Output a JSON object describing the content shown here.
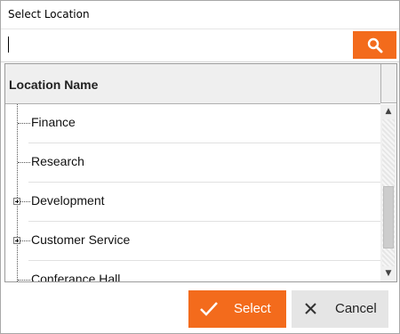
{
  "window": {
    "title": "Select Location"
  },
  "search": {
    "value": "",
    "placeholder": ""
  },
  "grid": {
    "column_header": "Location Name",
    "rows": [
      {
        "label": "Finance",
        "expandable": false
      },
      {
        "label": "Research",
        "expandable": false
      },
      {
        "label": "Development",
        "expandable": true
      },
      {
        "label": "Customer Service",
        "expandable": true
      },
      {
        "label": "Conferance Hall",
        "expandable": false
      }
    ]
  },
  "buttons": {
    "select_label": "Select",
    "cancel_label": "Cancel"
  },
  "icons": {
    "search": "magnifier-icon",
    "select": "checkmark-icon",
    "cancel": "close-x-icon"
  },
  "colors": {
    "accent": "#f36b1c",
    "cancel_bg": "#e5e5e5"
  }
}
